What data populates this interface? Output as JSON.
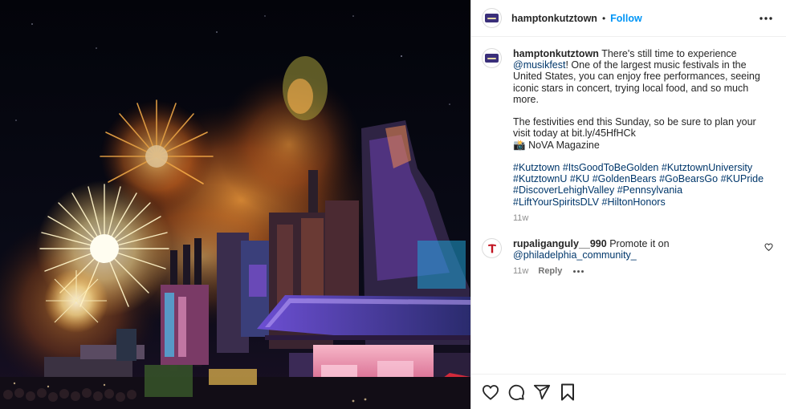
{
  "photo": {
    "alt_icon": "fireworks-photo"
  },
  "header": {
    "username": "hamptonkutztown",
    "separator": "•",
    "follow_label": "Follow"
  },
  "caption": {
    "username": "hamptonkutztown",
    "text_1": "There's still time to experience",
    "mention": "@musikfest",
    "text_2": "! One of the largest music festivals in the United States, you can enjoy free performances, seeing iconic stars in concert, trying local food, and so much more.",
    "text_3": "The festivities end this Sunday, so be sure to plan your visit today at bit.ly/45HfHCk",
    "credit_emoji": "📸",
    "credit": "NoVA Magazine",
    "hashtags": [
      "#Kutztown",
      "#ItsGoodToBeGolden",
      "#KutztownUniversity",
      "#KutztownU",
      "#KU",
      "#GoldenBears",
      "#GoBearsGo",
      "#KUPride",
      "#DiscoverLehighValley",
      "#Pennsylvania",
      "#LiftYourSpiritsDLV",
      "#HiltonHonors"
    ],
    "time": "11w"
  },
  "comment": {
    "username": "rupaliganguly__990",
    "text": "Promote it on",
    "mention": "@philadelphia_community_",
    "time": "11w",
    "reply_label": "Reply",
    "avatar_letter": "T"
  },
  "icons": {
    "more": "more-options-icon",
    "heart": "heart-icon",
    "comment": "comment-icon",
    "share": "share-icon",
    "save": "bookmark-icon"
  },
  "colors": {
    "link": "#00376b",
    "follow": "#0095f6",
    "text": "#262626",
    "muted": "#8e8e8e",
    "avatar_accent": "#c1121f"
  }
}
